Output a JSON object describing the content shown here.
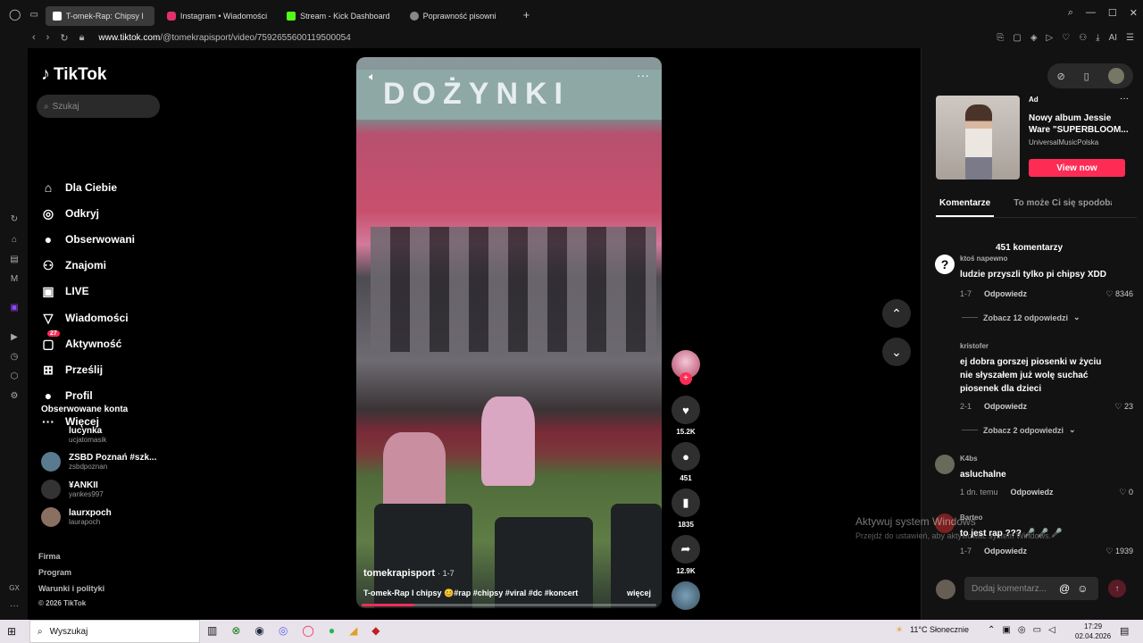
{
  "browser": {
    "tabs": [
      {
        "label": "T-omek-Rap: Chipsy I",
        "color": "#ffffff",
        "active": true
      },
      {
        "label": "Instagram • Wiadomości",
        "color": "#e1306c",
        "active": false
      },
      {
        "label": "Stream - Kick Dashboard",
        "color": "#53fc18",
        "active": false
      },
      {
        "label": "Poprawność pisowni",
        "color": "#dddddd",
        "active": false
      }
    ],
    "url_host": "www.tiktok.com",
    "url_path": "/@tomekrapisport/video/7592655600119500054"
  },
  "tiktok": {
    "logo": "TikTok",
    "search_placeholder": "Szukaj",
    "nav": [
      {
        "label": "Dla Ciebie",
        "icon": "home-icon",
        "glyph": "⌂"
      },
      {
        "label": "Odkryj",
        "icon": "compass-icon",
        "glyph": "◎"
      },
      {
        "label": "Obserwowani",
        "icon": "avatar-icon",
        "glyph": "●"
      },
      {
        "label": "Znajomi",
        "icon": "friends-icon",
        "glyph": "⚇"
      },
      {
        "label": "LIVE",
        "icon": "live-icon",
        "glyph": "▣"
      },
      {
        "label": "Wiadomości",
        "icon": "messages-icon",
        "glyph": "▽"
      },
      {
        "label": "Aktywność",
        "icon": "activity-icon",
        "glyph": "▢",
        "badge": "27"
      },
      {
        "label": "Prześlij",
        "icon": "upload-icon",
        "glyph": "⊞"
      },
      {
        "label": "Profil",
        "icon": "profile-icon",
        "glyph": "●"
      },
      {
        "label": "Więcej",
        "icon": "more-icon",
        "glyph": "···"
      }
    ],
    "followed_heading": "Obserwowane konta",
    "followed": [
      {
        "name": "lucynka",
        "handle": "ucjatomasik"
      },
      {
        "name": "ZSBD Poznań #szk...",
        "handle": "zsbdpoznan"
      },
      {
        "name": "¥ANKII",
        "handle": "yankes997"
      },
      {
        "name": "laurxpoch",
        "handle": "laurapoch"
      }
    ],
    "footer": [
      "Firma",
      "Program",
      "Warunki i polityki",
      "© 2026 TikTok"
    ]
  },
  "video": {
    "banner_text": "DOŻYNKI",
    "author": "tomekrapisport",
    "date": "· 1-7",
    "caption": "T-omek-Rap I chipsy 😊#rap #chipsy #viral #dc #koncert",
    "more_label": "więcej",
    "progress": 0.18
  },
  "actions": {
    "likes": "15.2K",
    "comments": "451",
    "saves": "1835",
    "shares": "12.9K"
  },
  "ad": {
    "label": "Ad",
    "title": "Nowy album Jessie Ware \"SUPERBLOOM...",
    "sponsor": "UniversalMusicPolska",
    "button": "View now"
  },
  "panel": {
    "tab_comments": "Komentarze",
    "tab_suggested": "To może Ci się spodobać",
    "count": "451 komentarzy",
    "reply_label": "Odpowiedz",
    "comments": [
      {
        "user": "ktoś napewno",
        "text": "ludzie przyszli tylko pi chipsy XDD",
        "date": "1-7",
        "likes": "8346",
        "replies": "Zobacz 12 odpowiedzi"
      },
      {
        "user": "kristofer",
        "text": "ej dobra gorszej piosenki w życiu nie słyszałem już wolę suchać piosenek dla dzieci",
        "date": "2-1",
        "likes": "23",
        "replies": "Zobacz 2 odpowiedzi"
      },
      {
        "user": "K4bs",
        "text": "asluchalne",
        "date": "1 dn. temu",
        "likes": "0"
      },
      {
        "user": "Barteo",
        "text": "to jest rap ??? 🎤 🎤 🎤",
        "date": "1-7",
        "likes": "1939"
      }
    ],
    "add_comment_placeholder": "Dodaj komentarz..."
  },
  "windows": {
    "activate_title": "Aktywuj system Windows",
    "activate_sub": "Przejdź do ustawień, aby aktywować system Windows.",
    "search": "Wyszukaj",
    "weather": "11°C  Słonecznie",
    "time": "17:29",
    "date": "02.04.2026"
  },
  "colors": {
    "accent": "#fe2c55",
    "bg": "#000000",
    "panel": "#121212"
  }
}
